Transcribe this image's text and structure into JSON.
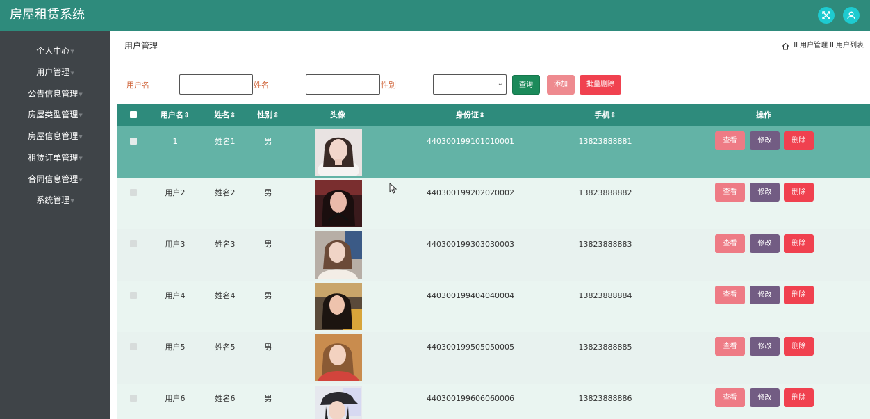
{
  "header": {
    "app_title": "房屋租赁系统",
    "icons": [
      "fullscreen-icon",
      "user-icon"
    ],
    "colors": {
      "topbar": "#2e8b7c",
      "icon_bg": "#1ecbd0"
    }
  },
  "sidebar": {
    "background": "#3f4448",
    "items": [
      {
        "label": "个人中心"
      },
      {
        "label": "用户管理"
      },
      {
        "label": "公告信息管理"
      },
      {
        "label": "房屋类型管理"
      },
      {
        "label": "房屋信息管理"
      },
      {
        "label": "租赁订单管理"
      },
      {
        "label": "合同信息管理"
      },
      {
        "label": "系统管理"
      }
    ]
  },
  "page": {
    "title": "用户管理",
    "breadcrumb": [
      "用户管理",
      "用户列表"
    ],
    "breadcrumb_separator": "II"
  },
  "filters": {
    "username_label": "用户名",
    "username_value": "",
    "name_label": "姓名",
    "name_value": "",
    "gender_label": "性别",
    "gender_selected": "",
    "search_button": "查询",
    "add_button": "添加",
    "batch_delete_button": "批量删除"
  },
  "table": {
    "columns": [
      "用户名",
      "姓名",
      "性别",
      "头像",
      "身份证",
      "手机",
      "操作"
    ],
    "sortable": [
      "用户名",
      "姓名",
      "性别",
      "身份证",
      "手机"
    ],
    "actions": {
      "view": "查看",
      "edit": "修改",
      "delete": "删除"
    },
    "colors": {
      "header": "#2e8b7c",
      "selected_row": "#63b3a6",
      "row_odd": "#e8f2ef",
      "row_even": "#eaf5f1"
    },
    "rows": [
      {
        "username": "1",
        "name": "姓名1",
        "gender": "男",
        "id_card": "440300199101010001",
        "phone": "13823888881",
        "selected": true
      },
      {
        "username": "用户2",
        "name": "姓名2",
        "gender": "男",
        "id_card": "440300199202020002",
        "phone": "13823888882",
        "selected": false
      },
      {
        "username": "用户3",
        "name": "姓名3",
        "gender": "男",
        "id_card": "440300199303030003",
        "phone": "13823888883",
        "selected": false
      },
      {
        "username": "用户4",
        "name": "姓名4",
        "gender": "男",
        "id_card": "440300199404040004",
        "phone": "13823888884",
        "selected": false
      },
      {
        "username": "用户5",
        "name": "姓名5",
        "gender": "男",
        "id_card": "440300199505050005",
        "phone": "13823888885",
        "selected": false
      },
      {
        "username": "用户6",
        "name": "姓名6",
        "gender": "男",
        "id_card": "440300199606060006",
        "phone": "13823888886",
        "selected": false
      }
    ]
  }
}
